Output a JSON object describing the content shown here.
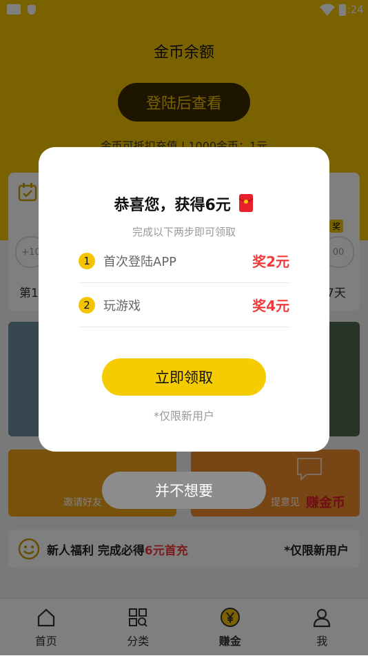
{
  "status_bar": {
    "time": "4:24"
  },
  "hero": {
    "title": "金币余额",
    "login_button": "登陆后查看",
    "rate_text": "金币可抵扣充值 | 1000金币：1元"
  },
  "checkin": {
    "badge": "奖",
    "left_bubble": "+10",
    "right_bubble": "00",
    "left_day": "第1",
    "right_day": "7天"
  },
  "banners": {
    "invite_label": "邀请好友",
    "feedback_label": "提意见",
    "earn_label": "赚金币"
  },
  "newbie": {
    "prefix": "新人福利 完成必得",
    "highlight": "6元首充",
    "note": "*仅限新用户"
  },
  "bottom_nav": [
    {
      "label": "首页"
    },
    {
      "label": "分类"
    },
    {
      "label": "赚金"
    },
    {
      "label": "我"
    }
  ],
  "dialog": {
    "title": "恭喜您，获得6元",
    "subtitle": "完成以下两步即可领取",
    "steps": [
      {
        "num": "1",
        "label": "首次登陆APP",
        "reward": "奖2元"
      },
      {
        "num": "2",
        "label": "玩游戏",
        "reward": "奖4元"
      }
    ],
    "claim_button": "立即领取",
    "limit_note": "*仅限新用户",
    "dismiss_button": "并不想要"
  },
  "colors": {
    "accent": "#f5c400",
    "reward_red": "#f23a3a"
  }
}
